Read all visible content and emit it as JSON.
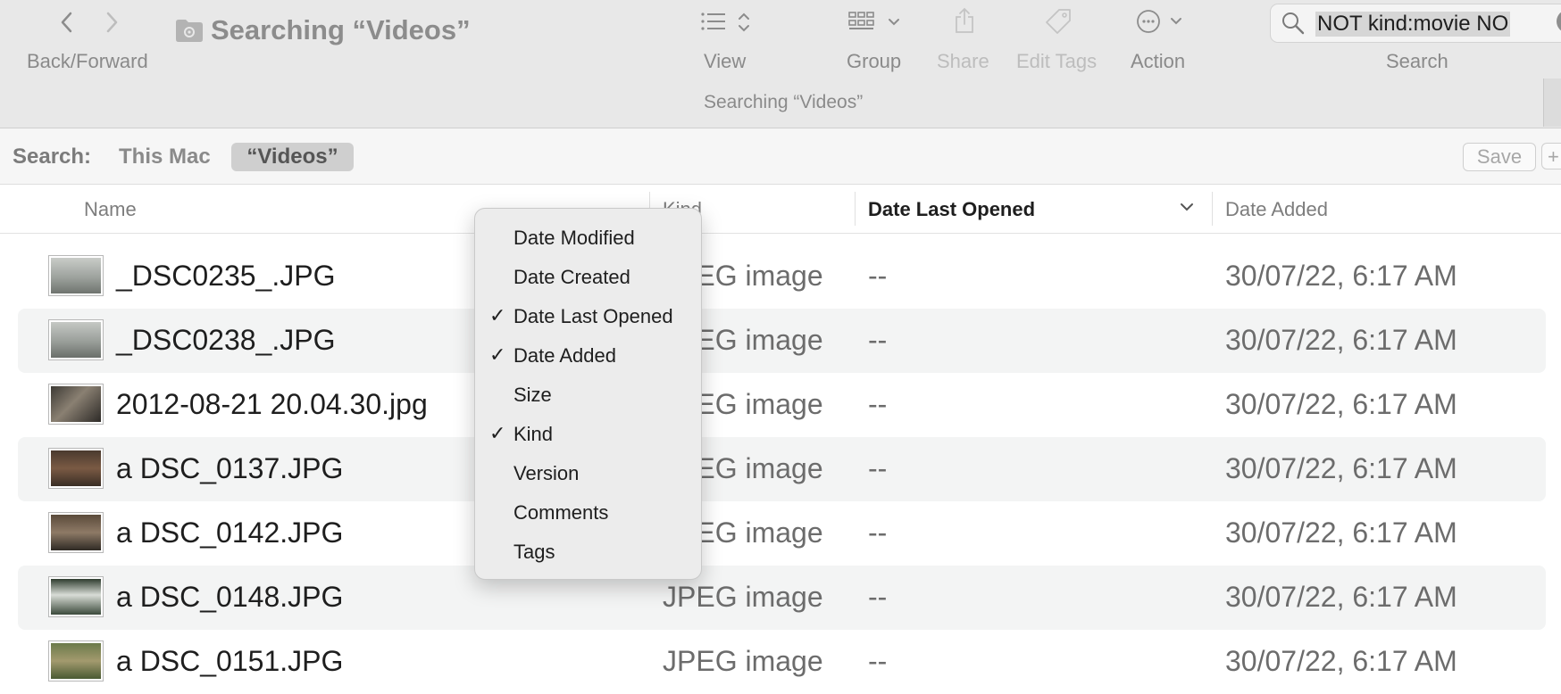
{
  "toolbar": {
    "back_forward_label": "Back/Forward",
    "window_title": "Searching “Videos”",
    "subtitle": "Searching “Videos”",
    "view_label": "View",
    "group_label": "Group",
    "share_label": "Share",
    "edit_tags_label": "Edit Tags",
    "action_label": "Action",
    "search_label": "Search",
    "search_value": "NOT kind:movie NO"
  },
  "scope": {
    "label": "Search:",
    "this_mac": "This Mac",
    "videos": "“Videos”",
    "save": "Save",
    "add": "+"
  },
  "columns": {
    "name": "Name",
    "kind": "Kind",
    "date_last_opened": "Date Last Opened",
    "date_added": "Date Added"
  },
  "files": [
    {
      "name": "_DSC0235_.JPG",
      "kind": "JPEG image",
      "opened": "--",
      "added": "30/07/22, 6:17 AM"
    },
    {
      "name": "_DSC0238_.JPG",
      "kind": "JPEG image",
      "opened": "--",
      "added": "30/07/22, 6:17 AM"
    },
    {
      "name": "2012-08-21 20.04.30.jpg",
      "kind": "JPEG image",
      "opened": "--",
      "added": "30/07/22, 6:17 AM"
    },
    {
      "name": "a DSC_0137.JPG",
      "kind": "JPEG image",
      "opened": "--",
      "added": "30/07/22, 6:17 AM"
    },
    {
      "name": "a DSC_0142.JPG",
      "kind": "JPEG image",
      "opened": "--",
      "added": "30/07/22, 6:17 AM"
    },
    {
      "name": "a DSC_0148.JPG",
      "kind": "JPEG image",
      "opened": "--",
      "added": "30/07/22, 6:17 AM"
    },
    {
      "name": "a DSC_0151.JPG",
      "kind": "JPEG image",
      "opened": "--",
      "added": "30/07/22, 6:17 AM"
    }
  ],
  "column_menu": {
    "items": [
      {
        "label": "Date Modified",
        "checked": false
      },
      {
        "label": "Date Created",
        "checked": false
      },
      {
        "label": "Date Last Opened",
        "checked": true
      },
      {
        "label": "Date Added",
        "checked": true
      },
      {
        "label": "Size",
        "checked": false
      },
      {
        "label": "Kind",
        "checked": true
      },
      {
        "label": "Version",
        "checked": false
      },
      {
        "label": "Comments",
        "checked": false
      },
      {
        "label": "Tags",
        "checked": false
      }
    ],
    "check_glyph": "✓"
  },
  "colors": {
    "toolbar_bg": "#e8e8e8",
    "row_alt_bg": "#f3f4f4",
    "menu_bg": "#ececec"
  }
}
